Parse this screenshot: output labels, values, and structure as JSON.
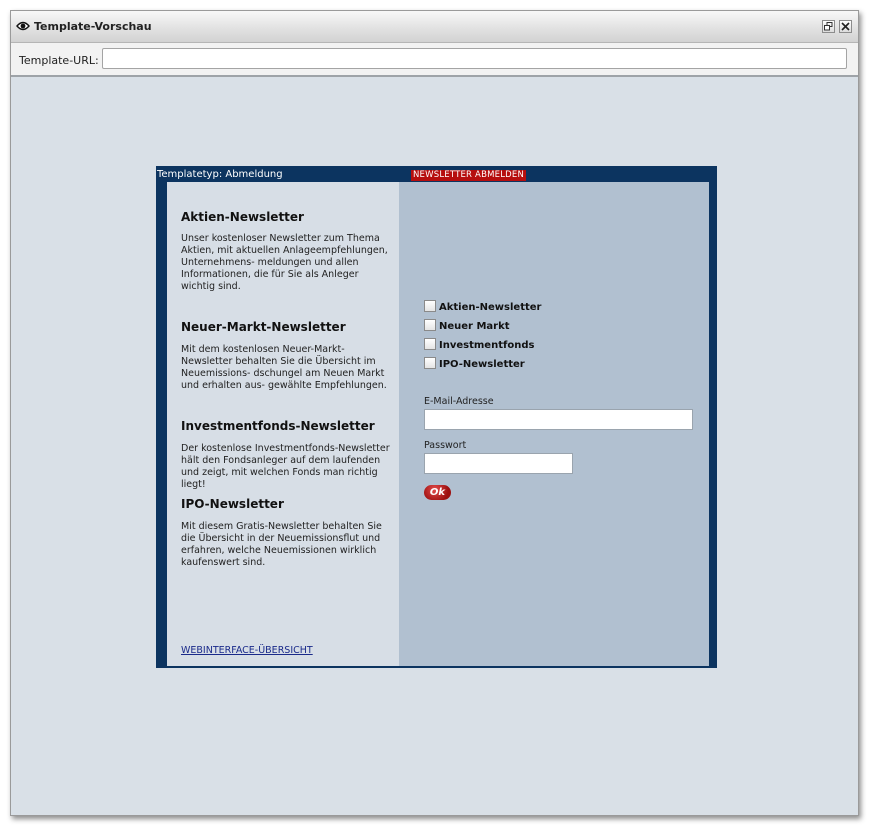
{
  "window": {
    "title": "Template-Vorschau",
    "icon": "eye-icon"
  },
  "urlbar": {
    "label": "Template-URL:",
    "value": "",
    "placeholder": ""
  },
  "template": {
    "type_label": "Templatetyp: Abmeldung",
    "badge": "NEWSLETTER ABMELDEN",
    "newsletters": [
      {
        "title": "Aktien-Newsletter",
        "description": "Unser kostenloser Newsletter zum Thema Aktien, mit aktuellen Anlageempfehlungen, Unternehmens- meldungen und allen Informationen, die für Sie als Anleger wichtig sind."
      },
      {
        "title": "Neuer-Markt-Newsletter",
        "description": "Mit dem kostenlosen Neuer-Markt-Newsletter behalten Sie die Übersicht im Neuemissions- dschungel am Neuen Markt und erhalten aus- gewählte Empfehlungen."
      },
      {
        "title": "Investmentfonds-Newsletter",
        "description": "Der kostenlose Investmentfonds-Newsletter hält den Fondsanleger auf dem laufenden und zeigt, mit welchen Fonds man richtig liegt!"
      },
      {
        "title": "IPO-Newsletter",
        "description": "Mit diesem Gratis-Newsletter behalten Sie die Übersicht in der Neuemissionsflut und erfahren, welche Neuemissionen wirklich kaufenswert sind."
      }
    ],
    "overview_link": "WEBINTERFACE-ÜBERSICHT",
    "checkboxes": [
      {
        "label": "Aktien-Newsletter",
        "checked": false
      },
      {
        "label": "Neuer Markt",
        "checked": false
      },
      {
        "label": "Investmentfonds",
        "checked": false
      },
      {
        "label": "IPO-Newsletter",
        "checked": false
      }
    ],
    "email_label": "E-Mail-Adresse",
    "email_value": "",
    "password_label": "Passwort",
    "password_value": "",
    "ok_button": "Ok"
  },
  "colors": {
    "frame": "#0c3460",
    "left_panel": "#d7dee6",
    "right_panel": "#b1c0d0",
    "badge": "#b60e0e",
    "workspace": "#d9e0e7"
  }
}
